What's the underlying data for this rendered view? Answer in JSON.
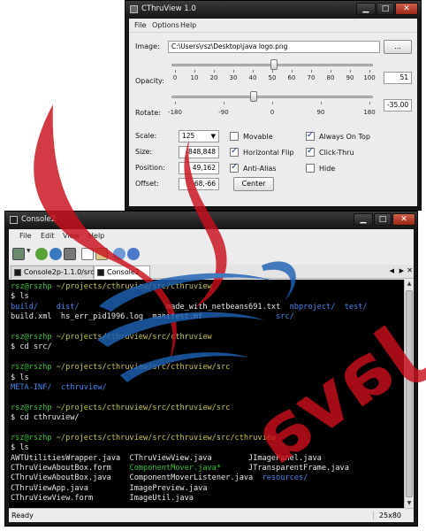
{
  "cthru": {
    "title": "CThruView 1.0",
    "menu": [
      "File",
      "Options",
      "Help"
    ],
    "image_label": "Image:",
    "image_path": "C:\\Users\\rsz\\Desktop\\java logo.png",
    "browse_label": "...",
    "opacity_label": "Opacity:",
    "opacity_ticks": [
      "0",
      "10",
      "20",
      "30",
      "40",
      "50",
      "60",
      "70",
      "80",
      "90",
      "100"
    ],
    "opacity_value": "51",
    "opacity_level": 51,
    "rotate_label": "Rotate:",
    "rotate_ticks": [
      "-180",
      "-90",
      "0",
      "90",
      "180"
    ],
    "rotate_value": "-35.00",
    "rotate_level": -35,
    "scale_label": "Scale:",
    "scale_value": "125",
    "size_label": "Size:",
    "size_value": "848,848",
    "position_label": "Position:",
    "position_value": "49,162",
    "offset_label": "Offset:",
    "offset_value": "-68,-66",
    "center_label": "Center",
    "checkboxes": [
      {
        "label": "Movable",
        "checked": false
      },
      {
        "label": "Horizontal Flip",
        "checked": true
      },
      {
        "label": "Anti-Alias",
        "checked": true
      },
      {
        "label": "Always On Top",
        "checked": true
      },
      {
        "label": "Click-Thru",
        "checked": true
      },
      {
        "label": "Hide",
        "checked": false
      }
    ]
  },
  "console": {
    "title": "Console2",
    "menu": [
      "File",
      "Edit",
      "View",
      "Help"
    ],
    "tabs": [
      {
        "label": "Console2p-1.1.0/src",
        "active": false
      },
      {
        "label": "Console2",
        "active": true
      }
    ],
    "status_text": "Ready",
    "status_size": "25x80",
    "lines": [
      [
        {
          "t": "rsz@rszhp ",
          "c": "green"
        },
        {
          "t": "~/projects/cthruview/src/cthruview",
          "c": "yellow"
        }
      ],
      [
        {
          "t": "$ ls",
          "c": "white"
        }
      ],
      [
        {
          "t": "build/",
          "c": "blue"
        },
        {
          "t": "    ",
          "c": "white"
        },
        {
          "t": "dist/",
          "c": "blue"
        },
        {
          "t": "                   made_with_netbeans691.txt  ",
          "c": "white"
        },
        {
          "t": "nbproject/",
          "c": "blue"
        },
        {
          "t": "  ",
          "c": "white"
        },
        {
          "t": "test/",
          "c": "blue"
        }
      ],
      [
        {
          "t": "build.xml  hs_err_pid1996.log  manifest.mf                ",
          "c": "white"
        },
        {
          "t": "src/",
          "c": "blue"
        }
      ],
      [],
      [
        {
          "t": "rsz@rszhp ",
          "c": "green"
        },
        {
          "t": "~/projects/cthruview/src/cthruview",
          "c": "yellow"
        }
      ],
      [
        {
          "t": "$ cd src/",
          "c": "white"
        }
      ],
      [],
      [
        {
          "t": "rsz@rszhp ",
          "c": "green"
        },
        {
          "t": "~/projects/cthruview/src/cthruview/src",
          "c": "yellow"
        }
      ],
      [
        {
          "t": "$ ls",
          "c": "white"
        }
      ],
      [
        {
          "t": "META-INF/",
          "c": "blue"
        },
        {
          "t": "  ",
          "c": "white"
        },
        {
          "t": "cthruview/",
          "c": "blue"
        }
      ],
      [],
      [
        {
          "t": "rsz@rszhp ",
          "c": "green"
        },
        {
          "t": "~/projects/cthruview/src/cthruview/src",
          "c": "yellow"
        }
      ],
      [
        {
          "t": "$ cd cthruview/",
          "c": "white"
        }
      ],
      [],
      [
        {
          "t": "rsz@rszhp ",
          "c": "green"
        },
        {
          "t": "~/projects/cthruview/src/cthruview/src/cthruview",
          "c": "yellow"
        }
      ],
      [
        {
          "t": "$ ls",
          "c": "white"
        }
      ],
      [
        {
          "t": "AWTUtilitiesWrapper.java  CThruViewView.java        JImagePanel.java",
          "c": "white"
        }
      ],
      [
        {
          "t": "CThruViewAboutBox.form    ",
          "c": "white"
        },
        {
          "t": "ComponentMover.java*",
          "c": "green"
        },
        {
          "t": "      JTransparentFrame.java",
          "c": "white"
        }
      ],
      [
        {
          "t": "CThruViewAboutBox.java    ComponentMoverListener.java  ",
          "c": "white"
        },
        {
          "t": "resources/",
          "c": "blue"
        }
      ],
      [
        {
          "t": "CThruViewApp.java         ImagePreview.java",
          "c": "white"
        }
      ],
      [
        {
          "t": "CThruViewView.form        ImageUtil.java",
          "c": "white"
        }
      ],
      [],
      [
        {
          "t": "rsz@rszhp ",
          "c": "green"
        },
        {
          "t": "~/projects/cthruview/src/cthruview/src/cthruview",
          "c": "yellow"
        }
      ],
      [
        {
          "t": "$ ",
          "c": "white"
        },
        {
          "cursor": true
        }
      ]
    ]
  },
  "overlay": {
    "logo_text": "Java",
    "colors": {
      "red": "#c8101e",
      "blue": "#1f62b5"
    }
  }
}
